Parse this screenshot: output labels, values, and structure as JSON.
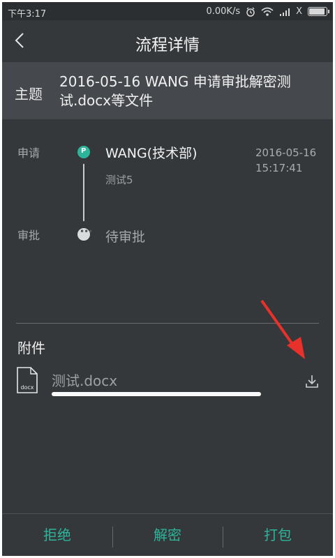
{
  "status_bar": {
    "time": "下午3:17",
    "net_speed": "0.00K/s",
    "carrier_mark": "X"
  },
  "header": {
    "title": "流程详情"
  },
  "subject": {
    "label": "主题",
    "text": "2016-05-16 WANG 申请审批解密测试.docx等文件"
  },
  "timeline": {
    "apply": {
      "label": "申请",
      "dot_letter": "P",
      "name": "WANG(技术部)",
      "note": "测试5",
      "date": "2016-05-16",
      "time": "15:17:41"
    },
    "approve": {
      "label": "审批",
      "dot_glyph": "•••",
      "status": "待审批"
    }
  },
  "attachments": {
    "title": "附件",
    "files": [
      {
        "icon_label": "docx",
        "name": "测试.docx",
        "progress": 1.0
      }
    ]
  },
  "footer": {
    "reject": "拒绝",
    "decrypt": "解密",
    "package": "打包"
  },
  "colors": {
    "accent": "#2cb59a",
    "background": "#35383b",
    "subject_bg": "#45484c",
    "annotation_arrow": "#e8312a"
  }
}
